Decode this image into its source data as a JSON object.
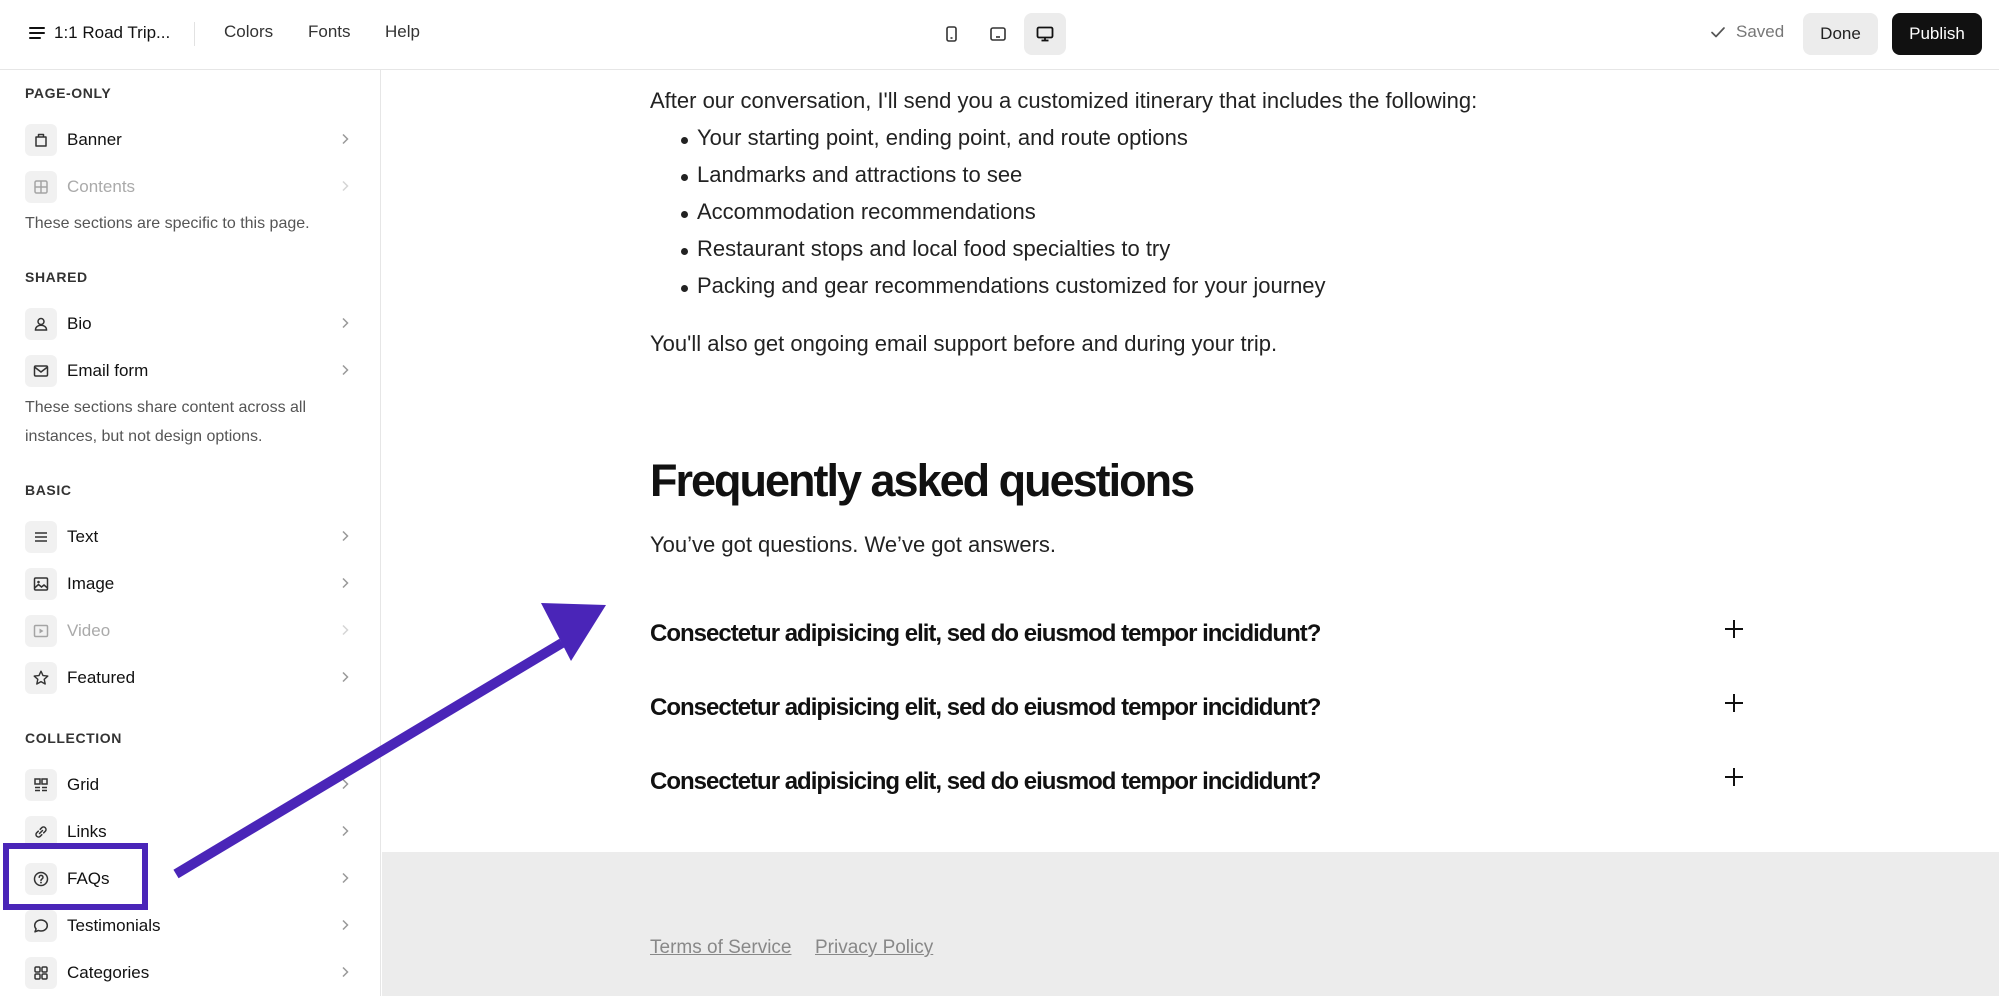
{
  "header": {
    "site_title": "1:1 Road Trip...",
    "nav": [
      "Colors",
      "Fonts",
      "Help"
    ],
    "devices": [
      "mobile-icon",
      "tablet-icon",
      "desktop-icon"
    ],
    "active_device": "desktop",
    "saved_label": "Saved",
    "done_label": "Done",
    "publish_label": "Publish"
  },
  "sidebar": {
    "page_only": {
      "heading": "PAGE-ONLY",
      "items": [
        {
          "label": "Banner",
          "icon": "banner-icon",
          "enabled": true
        },
        {
          "label": "Contents",
          "icon": "contents-icon",
          "enabled": false
        }
      ],
      "note": "These sections are specific to this page."
    },
    "shared": {
      "heading": "SHARED",
      "items": [
        {
          "label": "Bio",
          "icon": "person-icon",
          "enabled": true
        },
        {
          "label": "Email form",
          "icon": "envelope-icon",
          "enabled": true
        }
      ],
      "note": "These sections share content across all instances, but not design options."
    },
    "basic": {
      "heading": "BASIC",
      "items": [
        {
          "label": "Text",
          "icon": "text-lines-icon",
          "enabled": true
        },
        {
          "label": "Image",
          "icon": "image-icon",
          "enabled": true
        },
        {
          "label": "Video",
          "icon": "video-play-icon",
          "enabled": false
        },
        {
          "label": "Featured",
          "icon": "star-icon",
          "enabled": true
        }
      ]
    },
    "collection": {
      "heading": "COLLECTION",
      "items": [
        {
          "label": "Grid",
          "icon": "grid-icon",
          "enabled": true
        },
        {
          "label": "Links",
          "icon": "link-icon",
          "enabled": true
        },
        {
          "label": "FAQs",
          "icon": "question-circle-icon",
          "enabled": true,
          "highlighted": true
        },
        {
          "label": "Testimonials",
          "icon": "speech-bubble-icon",
          "enabled": true
        },
        {
          "label": "Categories",
          "icon": "categories-icon",
          "enabled": true
        }
      ]
    }
  },
  "main": {
    "intro": "After our conversation, I'll send you a customized itinerary that includes the following:",
    "bullets": [
      "Your starting point, ending point, and route options",
      "Landmarks and attractions to see",
      "Accommodation recommendations",
      "Restaurant stops and local food specialties to try",
      "Packing and gear recommendations customized for your journey"
    ],
    "support": "You'll also get ongoing email support before and during your trip.",
    "faq": {
      "title": "Frequently asked questions",
      "subtitle": "You’ve got questions. We’ve got answers.",
      "questions": [
        "Consectetur adipisicing elit, sed do eiusmod tempor incididunt?",
        "Consectetur adipisicing elit, sed do eiusmod tempor incididunt?",
        "Consectetur adipisicing elit, sed do eiusmod tempor incididunt?"
      ]
    },
    "footer_links": [
      "Terms of Service",
      "Privacy Policy"
    ]
  },
  "annotation": {
    "color": "#4a25b8",
    "highlight_target": "FAQs",
    "arrow_points_to": "faq-section"
  }
}
